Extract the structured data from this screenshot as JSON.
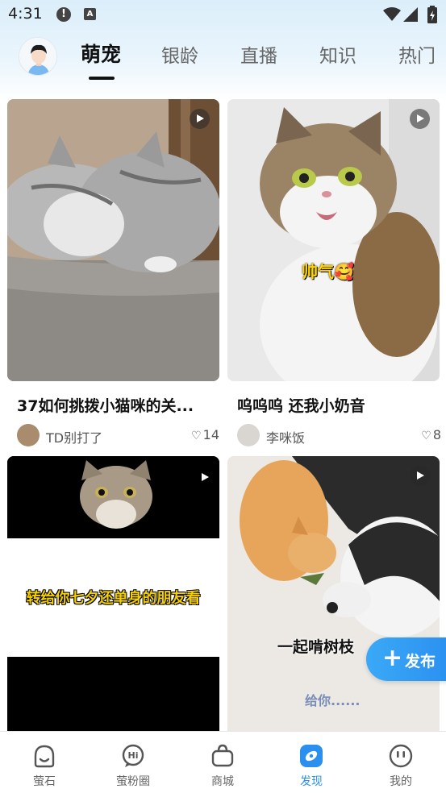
{
  "status_bar": {
    "time": "4:31"
  },
  "header": {
    "tabs": [
      {
        "label": "萌宠",
        "active": true
      },
      {
        "label": "银龄",
        "active": false
      },
      {
        "label": "直播",
        "active": false
      },
      {
        "label": "知识",
        "active": false
      },
      {
        "label": "热门",
        "active": false
      }
    ]
  },
  "feed": {
    "cards": [
      {
        "title": "37如何挑拨小猫咪的关...",
        "author": "TD别打了",
        "likes": "14",
        "caption": ""
      },
      {
        "title": "呜呜呜  还我小奶音",
        "author": "李咪饭",
        "likes": "8",
        "caption": "帅气🥰"
      },
      {
        "title": "",
        "author": "",
        "likes": "",
        "caption": "转给你七夕还单身的朋友看"
      },
      {
        "title": "",
        "author": "",
        "likes": "",
        "caption": "一起啃树枝",
        "caption2": "给你......"
      }
    ]
  },
  "fab": {
    "label": "发布",
    "plus": "+"
  },
  "bottom_nav": {
    "items": [
      {
        "label": "萤石",
        "icon": "face-icon",
        "active": false
      },
      {
        "label": "萤粉圈",
        "icon": "chat-hi-icon",
        "active": false
      },
      {
        "label": "商城",
        "icon": "shopping-bag-icon",
        "active": false
      },
      {
        "label": "发现",
        "icon": "discover-icon",
        "active": true
      },
      {
        "label": "我的",
        "icon": "profile-icon",
        "active": false
      }
    ]
  },
  "colors": {
    "accent": "#2b8ff0",
    "header_bg": "#dbeefa"
  }
}
